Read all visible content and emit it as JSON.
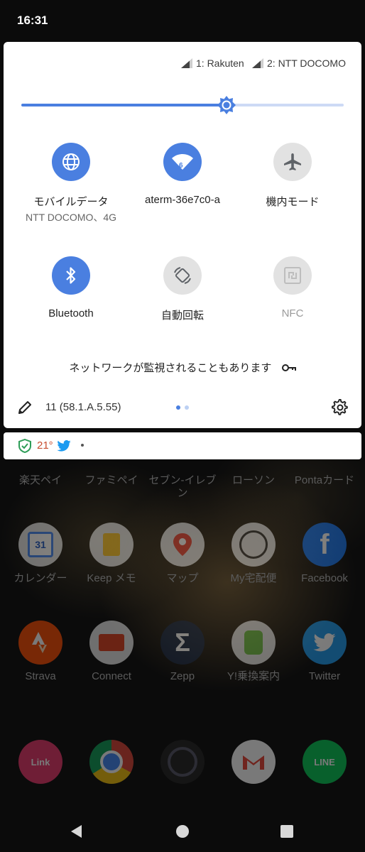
{
  "status_bar": {
    "time": "16:31"
  },
  "quick_settings": {
    "carriers": [
      {
        "label": "1: Rakuten"
      },
      {
        "label": "2: NTT DOCOMO"
      }
    ],
    "brightness_level": 0.64,
    "tiles": [
      {
        "label": "モバイルデータ",
        "sublabel": "NTT DOCOMO、4G",
        "state": "on",
        "icon": "globe-icon"
      },
      {
        "label": "aterm-36e7c0-a",
        "sublabel": "",
        "state": "on",
        "icon": "wifi-icon",
        "badge": "6"
      },
      {
        "label": "機内モード",
        "sublabel": "",
        "state": "off",
        "icon": "airplane-icon"
      },
      {
        "label": "Bluetooth",
        "sublabel": "",
        "state": "on",
        "icon": "bluetooth-icon"
      },
      {
        "label": "自動回転",
        "sublabel": "",
        "state": "off",
        "icon": "auto-rotate-icon"
      },
      {
        "label": "NFC",
        "sublabel": "",
        "state": "disabled",
        "icon": "nfc-icon"
      }
    ],
    "network_warning": "ネットワークが監視されることもあります",
    "build_number": "11 (58.1.A.5.55)",
    "page_count": 2,
    "current_page": 1
  },
  "notification_strip": {
    "temperature": "21°"
  },
  "apps": {
    "row1": [
      "楽天ペイ",
      "ファミペイ",
      "セブン-イレブン",
      "ローソン",
      "Pontaカード"
    ],
    "row2": [
      "カレンダー",
      "Keep メモ",
      "マップ",
      "My宅配便",
      "Facebook"
    ],
    "row3": [
      "Strava",
      "Connect",
      "Zepp",
      "Y!乗換案内",
      "Twitter"
    ],
    "row3_icons": [
      "strava-icon",
      "connect-icon",
      "zepp-icon",
      "train-icon",
      "twitter-icon"
    ],
    "dock": [
      "phone-icon",
      "chrome-icon",
      "camera-icon",
      "gmail-icon",
      "line-icon"
    ],
    "dock_text": {
      "phone": "Link",
      "line": "LINE",
      "calendar": "31"
    }
  },
  "colors": {
    "accent": "#4a7fe0",
    "tile_off": "#e2e2e2",
    "temperature": "#c84d30",
    "twitter": "#1d9bf0",
    "shield": "#2e9d58"
  }
}
